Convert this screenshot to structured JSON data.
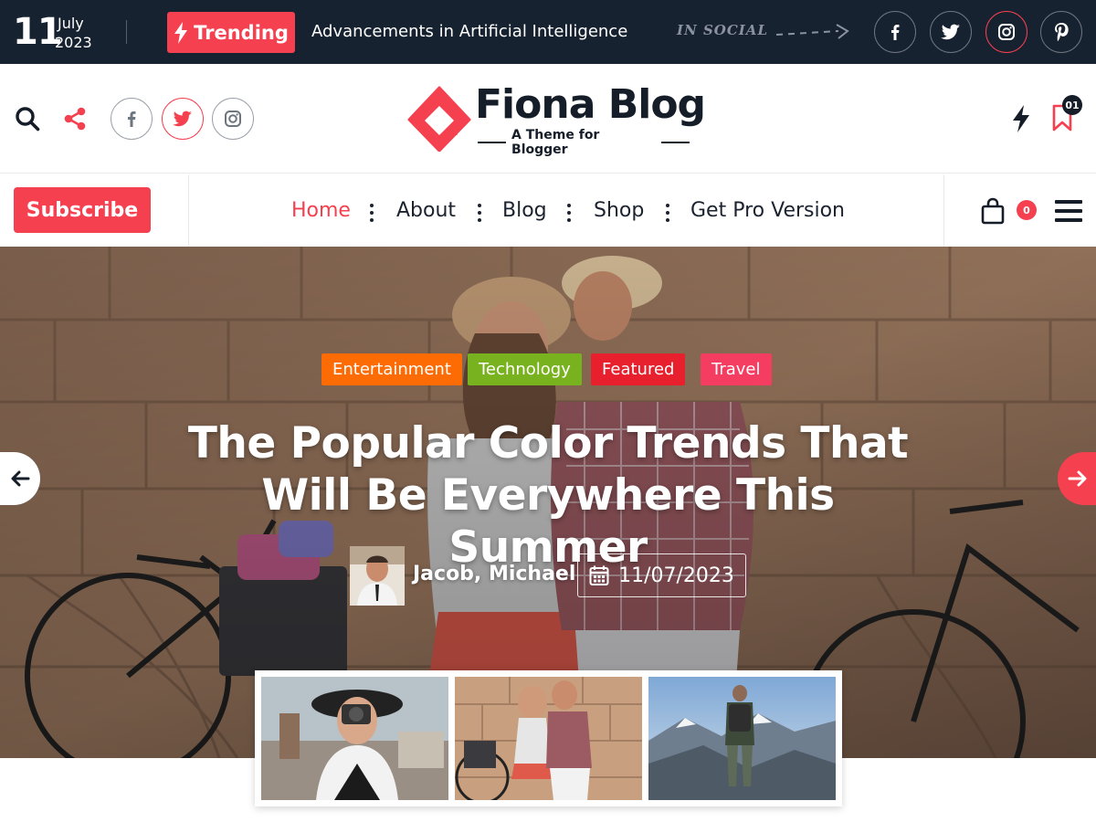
{
  "topbar": {
    "date_day": "11",
    "date_month": "July",
    "date_year": "2023",
    "trending_label": "Trending",
    "trending_text": "Advancements in Artificial Intelligence",
    "social_label": "IN SOCIAL",
    "social_icons": [
      "facebook-icon",
      "twitter-icon",
      "instagram-icon",
      "pinterest-icon"
    ]
  },
  "header": {
    "logo_title": "Fiona Blog",
    "logo_tagline": "A Theme for Blogger",
    "bookmark_count": "01",
    "social_icons": [
      "facebook-icon",
      "twitter-icon",
      "instagram-icon"
    ]
  },
  "nav": {
    "subscribe_label": "Subscribe",
    "items": [
      {
        "label": "Home",
        "active": true
      },
      {
        "label": "About",
        "active": false
      },
      {
        "label": "Blog",
        "active": false
      },
      {
        "label": "Shop",
        "active": false
      },
      {
        "label": "Get Pro Version",
        "active": false
      }
    ],
    "cart_count": "0"
  },
  "hero": {
    "categories": [
      {
        "label": "Entertainment",
        "color": "#fc6b04"
      },
      {
        "label": "Technology",
        "color": "#79b21f"
      },
      {
        "label": "Featured",
        "color": "#e81f2d"
      },
      {
        "label": "Travel",
        "color": "#f53d62"
      }
    ],
    "title": "The Popular Color Trends That Will Be Everywhere This Summer",
    "author": "Jacob, Michael",
    "date": "11/07/2023"
  },
  "colors": {
    "accent": "#f5404f",
    "topbar_bg": "#172230",
    "text_dark": "#1b2230"
  }
}
